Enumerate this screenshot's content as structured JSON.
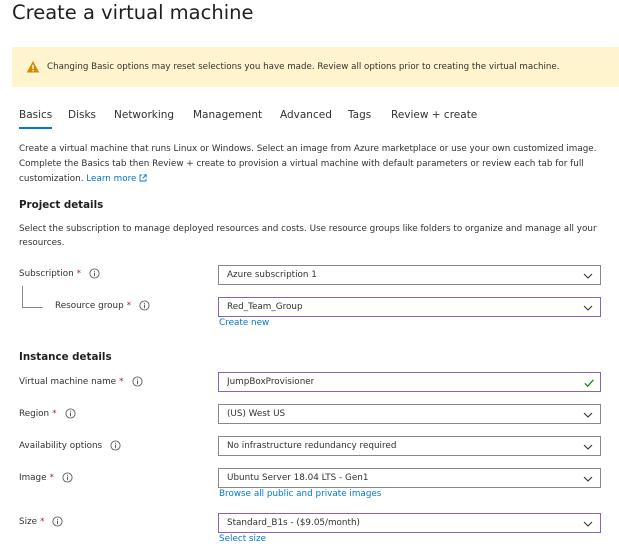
{
  "page": {
    "title": "Create a virtual machine"
  },
  "warning": {
    "icon": "warning-icon",
    "text": "Changing Basic options may reset selections you have made. Review all options prior to creating the virtual machine.",
    "icon_color": "#d48a00"
  },
  "tabs": [
    {
      "label": "Basics",
      "active": true
    },
    {
      "label": "Disks"
    },
    {
      "label": "Networking"
    },
    {
      "label": "Management"
    },
    {
      "label": "Advanced"
    },
    {
      "label": "Tags"
    },
    {
      "label": "Review + create"
    }
  ],
  "intro": {
    "text": "Create a virtual machine that runs Linux or Windows. Select an image from Azure marketplace or use your own customized image. Complete the Basics tab then Review + create to provision a virtual machine with default parameters or review each tab for full customization.",
    "learn_more": "Learn more"
  },
  "project": {
    "heading": "Project details",
    "description": "Select the subscription to manage deployed resources and costs. Use resource groups like folders to organize and manage all your resources.",
    "subscription": {
      "label": "Subscription",
      "value": "Azure subscription 1"
    },
    "resource_group": {
      "label": "Resource group",
      "value": "Red_Team_Group",
      "link": "Create new"
    }
  },
  "instance": {
    "heading": "Instance details",
    "vm_name": {
      "label": "Virtual machine name",
      "value": "JumpBoxProvisioner"
    },
    "region": {
      "label": "Region",
      "value": "(US) West US"
    },
    "availability": {
      "label": "Availability options",
      "value": "No infrastructure redundancy required"
    },
    "image": {
      "label": "Image",
      "value": "Ubuntu Server 18.04 LTS - Gen1",
      "link": "Browse all public and private images"
    },
    "size": {
      "label": "Size",
      "value": "Standard_B1s - ($9.05/month)",
      "link": "Select size"
    }
  },
  "colors": {
    "accent": "#0078d4",
    "focus_border": "#8764b8",
    "required": "#a4262c",
    "valid_check": "#107c10",
    "warning_bg": "#fff4ce"
  }
}
